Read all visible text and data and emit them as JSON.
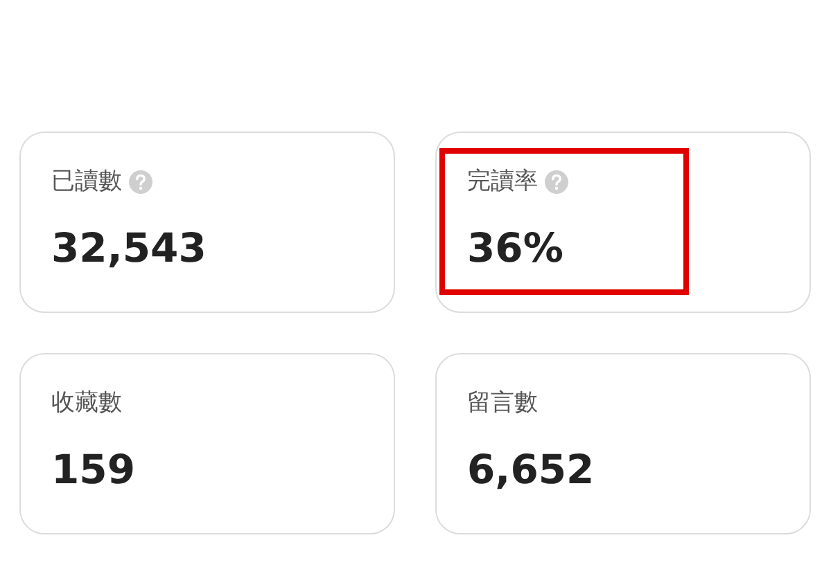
{
  "cards": [
    {
      "label": "已讀數",
      "help": true,
      "value": "32,543",
      "highlighted": false
    },
    {
      "label": "完讀率",
      "help": true,
      "value": "36%",
      "highlighted": true
    },
    {
      "label": "收藏數",
      "help": false,
      "value": "159",
      "highlighted": false
    },
    {
      "label": "留言數",
      "help": false,
      "value": "6,652",
      "highlighted": false
    }
  ]
}
